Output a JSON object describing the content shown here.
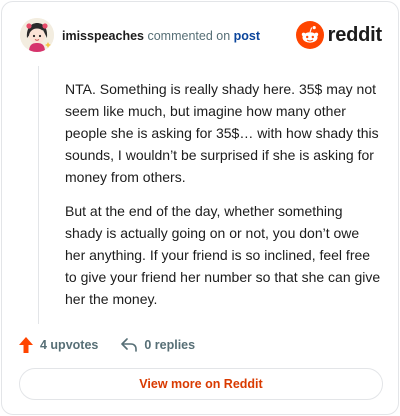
{
  "header": {
    "username": "imisspeaches",
    "action_text": "commented on",
    "post_link": "post",
    "brand_name": "reddit",
    "avatar_icon": "snoo-avatar-icon",
    "brand_icon": "reddit-logo-icon"
  },
  "comment": {
    "paragraphs": [
      "NTA. Something is really shady here. 35$ may not seem like much, but imagine how many other people she is asking for 35$… with how shady this sounds, I wouldn’t be surprised if she is asking for money from others.",
      "But at the end of the day, whether something shady is actually going on or not, you don’t owe her anything. If your friend is so inclined, feel free to give your friend her number so that she can give her the money."
    ]
  },
  "actions": {
    "upvotes_label": "4 upvotes",
    "replies_label": "0 replies",
    "upvote_icon": "upvote-arrow-icon",
    "reply_icon": "reply-arrow-icon"
  },
  "footer": {
    "view_more_label": "View more on Reddit"
  },
  "colors": {
    "brand_orange": "#ff4500",
    "link_blue": "#0a449b",
    "muted_text": "#576f76",
    "button_text": "#d93a00"
  }
}
